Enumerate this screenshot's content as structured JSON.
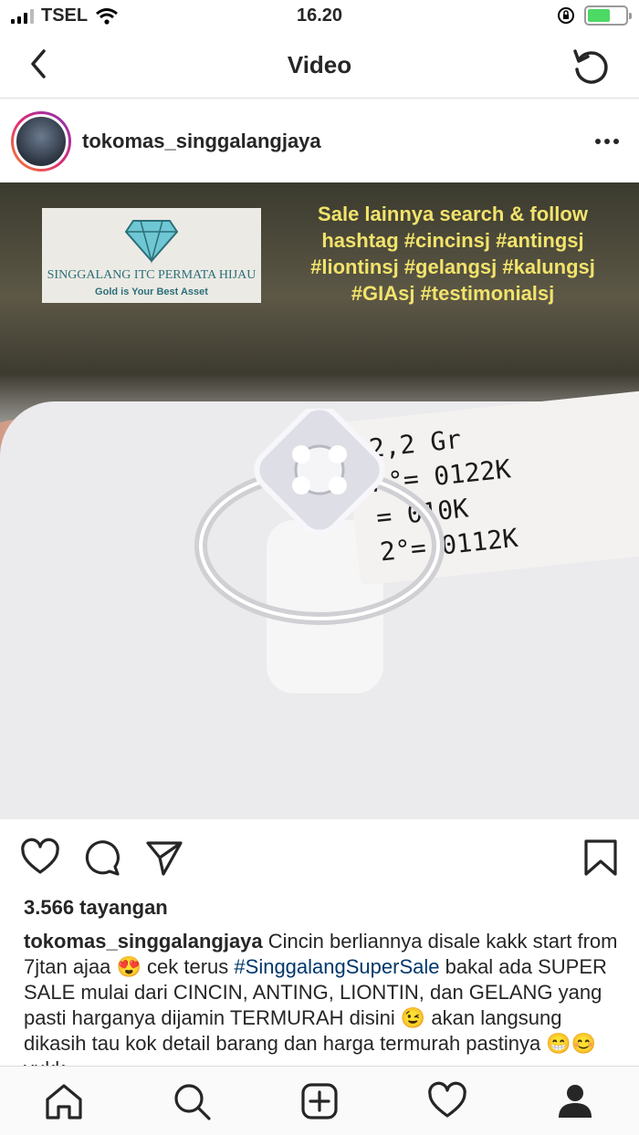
{
  "status_bar": {
    "carrier": "TSEL",
    "time": "16.20"
  },
  "header": {
    "title": "Video"
  },
  "post": {
    "username": "tokomas_singgalangjaya",
    "views": "3.566 tayangan",
    "caption_user": "tokomas_singgalangjaya",
    "caption_part1": " Cincin berliannya disale kakk start from 7jtan ajaa 😍 cek terus ",
    "caption_hashtag": "#SinggalangSuperSale",
    "caption_part2": " bakal ada SUPER SALE mulai dari CINCIN, ANTING, LIONTIN, dan GELANG yang pasti harganya dijamin TERMURAH disini 😉 akan langsung dikasih tau kok detail barang dan harga termurah pastinya 😁😊 yukk"
  },
  "video": {
    "logo_name": "SINGGALANG ITC PERMATA HIJAU",
    "logo_tagline": "Gold is Your Best Asset",
    "overlay_line1": "Sale lainnya search & follow",
    "overlay_line2": "hashtag #cincinsj #antingsj",
    "overlay_line3": "#liontinsj #gelangsj #kalungsj",
    "overlay_line4": "#GIAsj #testimonialsj",
    "tag_line1": "2,2 Gr",
    "tag_line2": "A°= 0122K",
    "tag_line3": "= 010K",
    "tag_line4": "2°= 0112K"
  },
  "icons": {
    "back": "chevron-left-icon",
    "refresh": "refresh-icon",
    "like": "heart-icon",
    "comment": "comment-icon",
    "share": "send-icon",
    "save": "bookmark-icon"
  }
}
